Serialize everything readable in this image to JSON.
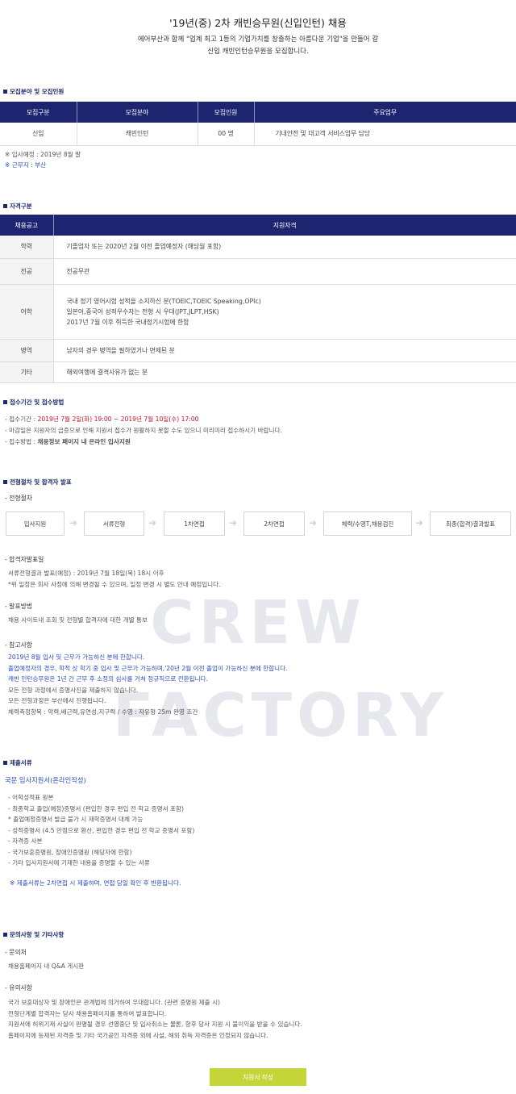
{
  "title": "'19년(중) 2차 캐빈승무원(신입인턴) 채용",
  "intro": [
    "에어부산과 함께 \"업계 최고 1등의 기업가치를 창출하는 아름다운 기업\"을 만들어 갈",
    "신입 캐빈인턴승무원을 모집합니다."
  ],
  "watermark": [
    "CREW",
    "FACTORY"
  ],
  "recruit": {
    "heading": "모집분야 및 모집인원",
    "columns": [
      "모집구분",
      "모집분야",
      "모집인원",
      "주요업무"
    ],
    "row": [
      "신입",
      "캐빈인턴",
      "00 명",
      "기내안전 및 대고객 서비스업무 담당"
    ],
    "notes": [
      "※ 입사예정 : 2019년 8월 말",
      "※ 근무지 : 부산"
    ]
  },
  "qualification": {
    "heading": "자격구분",
    "columns": [
      "채용공고",
      "지원자격"
    ],
    "rows": [
      {
        "label": "학력",
        "lines": [
          "기졸업자 또는 2020년 2월 이전 졸업예정자 (해당월 포함)"
        ]
      },
      {
        "label": "전공",
        "lines": [
          "전공무관"
        ]
      },
      {
        "label": "어학",
        "lines": [
          "국내 정기 영어시험 성적을 소지하신 분(TOEIC,TOEIC Speaking,OPIc)",
          "일본어,중국어 성적우수자는 전형 시 우대(JPT,JLPT,HSK)",
          "2017년 7월 이후 취득한 국내정기시험에 한함"
        ]
      },
      {
        "label": "병역",
        "lines": [
          "남자의 경우 병역을 필하였거나 면제된 분"
        ]
      },
      {
        "label": "기타",
        "lines": [
          "해외여행에 결격사유가 없는 분"
        ]
      }
    ]
  },
  "application": {
    "heading": "접수기간 및 접수방법",
    "period_label": "- 접수기간 : ",
    "period_value": "2019년 7월 2일(화) 19:00 ~ 2019년 7월 10일(수) 17:00",
    "period_note": "- 마감일은 지원자의 급증으로 인해 지원서 접수가 원활하지 못할 수도 있으니 미리미리 접수하시기 바랍니다.",
    "method_label": "- 접수방법 : ",
    "method_value": "채용정보 페이지 내 온라인 입사지원"
  },
  "process": {
    "heading": "전형절차 및 합격자 발표",
    "steps_title": "- 전형절차",
    "steps": [
      "입사지원",
      "서류전형",
      "1차면접",
      "2차면접",
      "체력/수영T,채용검진",
      "최종(합격)결과발표"
    ],
    "schedule_title": "- 합격자발표일",
    "schedule_lines": [
      "서류전형결과 발표(예정) : 2019년 7월 18일(목) 18시 이후",
      "*위 일정은 회사 사정에 의해 변경될 수 있으며, 일정 변경 시 별도 안내 예정입니다."
    ],
    "announce_title": "- 발표방법",
    "announce_line": "채용 사이트내 조회 및 전형별 합격자에 대한 개별 통보",
    "ref_title": "- 참고사항",
    "ref_blue": [
      "2019년 8월 입사 및 근무가 가능하신 분에 한합니다.",
      "졸업예정자의 경우, 학적 상 학기 중 입사 및 근무가 가능하며,'20년 2월 이전 졸업이 가능하신 분에 한합니다.",
      "캐빈 인턴승무원은 1년 간 근무 후 소정의 심사를 거쳐 정규직으로 전환됩니다."
    ],
    "ref_gray": [
      "모든 전형 과정에서 증명사진을 제출하지 않습니다.",
      "모든 전형과정은 부산에서 진행됩니다.",
      "체력측정항목 : 악력,배근력,유연성,지구력 / 수영 : 자유형 25m 완영 조건"
    ]
  },
  "documents": {
    "heading": "제출서류",
    "form": "국문 입사지원서(온라인작성)",
    "items": [
      "- 어학성적표 원본",
      "- 최종학교 졸업(예정)증명서 (편입한 경우 편입 전 학교 증명서 포함)",
      "* 졸업예정증명서 발급 불가 시 재학증명서 대체 가능",
      "- 성적증명서 (4.5 만점으로 환산, 편입한 경우 편입 전 학교 증명서 포함)",
      "- 자격증 사본",
      "- 국가보훈증명원, 장애인증명원 (해당자에 한함)",
      "- 기타 입사지원서에 기재한 내용을 증명할 수 있는 서류"
    ],
    "note": "※ 제출서류는 2차면접 시 제출하며, 면접 당일 확인 후 반환됩니다."
  },
  "contact": {
    "heading": "문의사항 및 기타사항",
    "inquiry_title": "- 문의처",
    "inquiry_line": "채용홈페이지 내 Q&A 게시판",
    "caution_title": "- 유의사항",
    "caution_lines": [
      "국가 보훈대상자 및 장애인은 관계법에 의거하여 우대합니다. (관련 증명원 제출 시)",
      "전형단계별 합격자는 당사 채용홈페이지를 통하여 발표합니다.",
      "지원서에 허위기재 사실이 판명될 경우 선영중단 및 입사취소는 물론, 향후 당사 지원 시 불이익을 받을 수 있습니다.",
      "홈페이지에 등재된 자격증 및 기타 국가공인 자격증 외에 사설, 해외 취득 자격증은 인정되지 않습니다."
    ]
  },
  "apply_button": "지원서 작성",
  "colors": {
    "navy": "#1e2570",
    "red": "#c0122c",
    "blue": "#2a4ec0",
    "button": "#c4d53a"
  }
}
